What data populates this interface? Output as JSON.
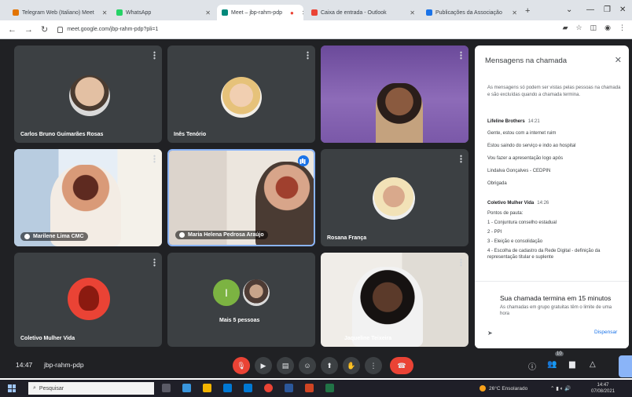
{
  "browser": {
    "tabs": [
      {
        "label": "Telegram Web (Italiano) Meet",
        "color": "#e37400"
      },
      {
        "label": "WhatsApp",
        "color": "#25d366"
      },
      {
        "label": "Meet – jbp-rahm-pdp",
        "color": "#00897b"
      },
      {
        "label": "Caixa de entrada - Outlook",
        "color": "#ea4335"
      },
      {
        "label": "Publicações da Associação",
        "color": "#1a73e8"
      }
    ],
    "url": "meet.google.com/jbp-rahm-pdp?pli=1"
  },
  "tiles": {
    "t1": {
      "name": "Carlos Bruno Guimarães Rosas"
    },
    "t2": {
      "name": "Inês Tenório"
    },
    "t4": {
      "name": "Marilene Lima CMC"
    },
    "t5": {
      "name": "Maria Helena Pedrosa Araújo"
    },
    "t6": {
      "name": "Rosana França"
    },
    "t7": {
      "name": "Coletivo Mulher Vida"
    },
    "t8": {
      "name": "Mais 5 pessoas",
      "avatar_letter": "I"
    },
    "t9": {
      "name": "Jaqueline Teixeira"
    }
  },
  "chat": {
    "title": "Mensagens na chamada",
    "notice": "As mensagens só podem ser vistas pelas pessoas na chamada e são excluídas quando a chamada termina.",
    "messages": [
      {
        "sender": "Lifeline Brothers",
        "time": "14:21",
        "lines": [
          "Gente, estou com a internet ruim",
          "Estou saindo do serviço e indo ao hospital",
          "Vou fazer a apresentação logo após",
          "Lindalva Gonçalves - CEDPIN",
          "Obrigada"
        ]
      },
      {
        "sender": "Coletivo Mulher Vida",
        "time": "14:26",
        "lines": [
          "Pontos de pauta:",
          "1 - Conjuntura conselho estadual",
          "2 - PPI",
          "3 - Eleição e consolidação",
          "4 - Escolha de cadastro da Rede Digital - definição da representação titular e suplente"
        ]
      }
    ],
    "ending_title": "Sua chamada termina em 15 minutos",
    "ending_text": "As chamadas em grupo gratuitas têm o limite de uma hora",
    "dismiss": "Dispensar"
  },
  "controls": {
    "clock": "14:47",
    "meet_code": "jbp-rahm-pdp",
    "participants_badge": "10"
  },
  "taskbar": {
    "search_placeholder": "Pesquisar",
    "weather": "26°C Ensolarado",
    "time": "14:47",
    "date": "07/08/2021"
  },
  "colors": {
    "stage": "#202124",
    "tile": "#3c4043",
    "accent": "#1a73e8",
    "danger": "#ea4335"
  }
}
